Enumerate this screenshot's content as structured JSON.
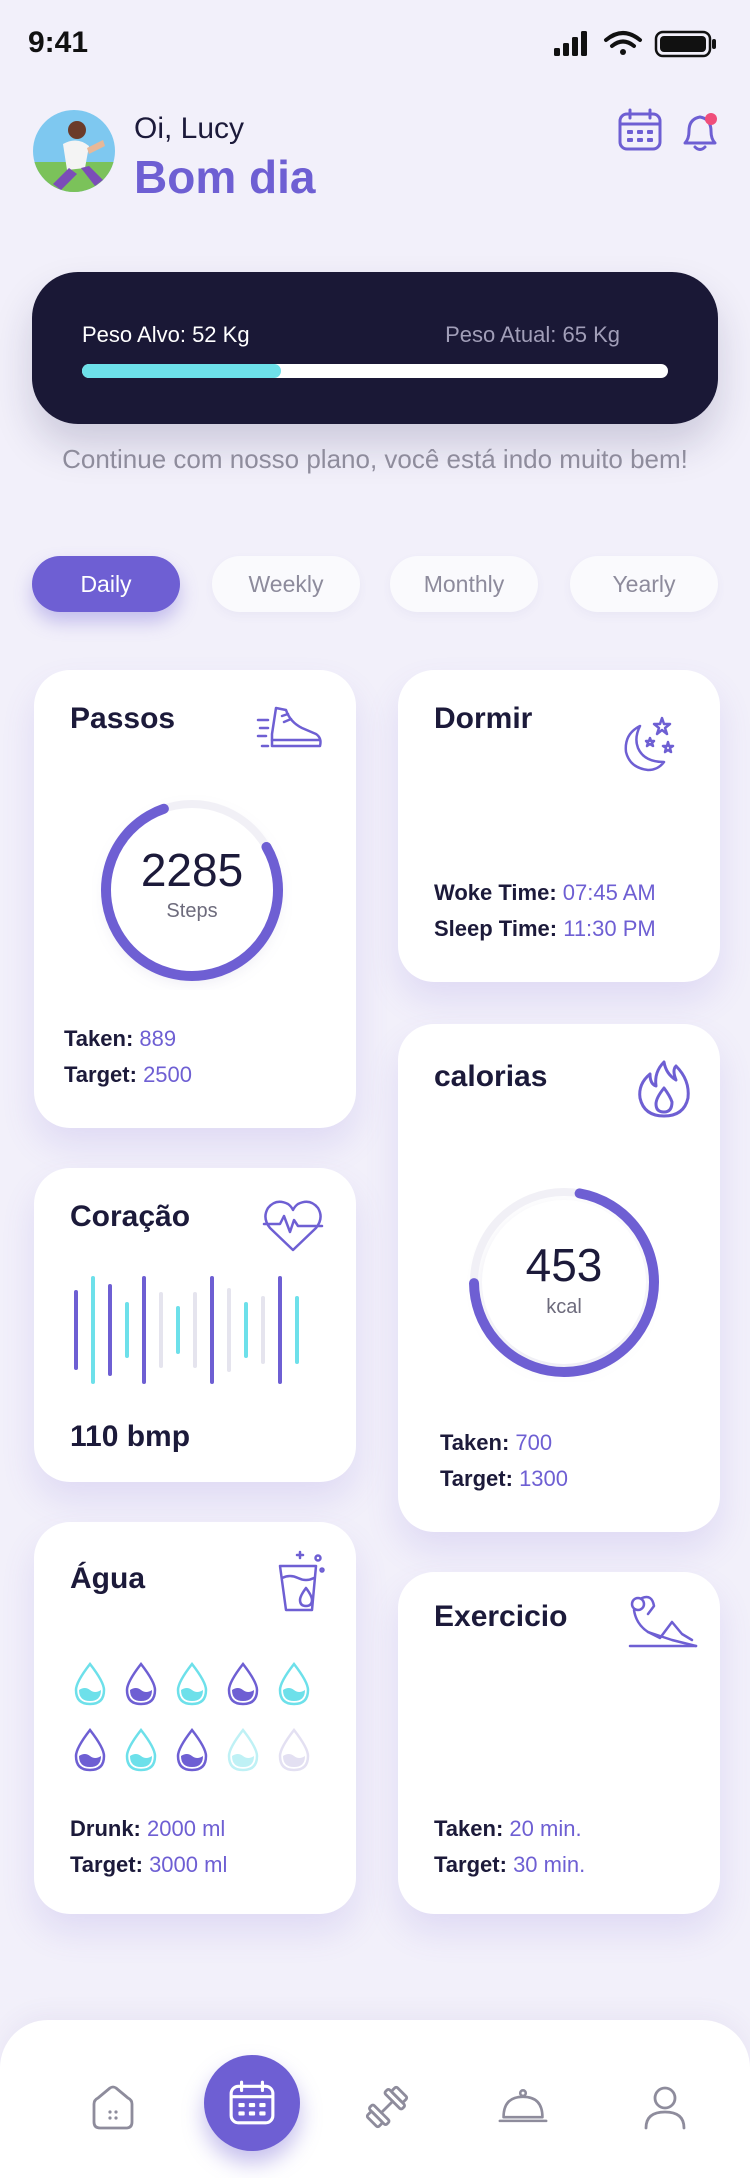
{
  "status_bar": {
    "time": "9:41"
  },
  "header": {
    "greeting": "Oi, Lucy",
    "subtitle": "Bom dia",
    "icons": [
      "calendar-icon",
      "bell-icon"
    ],
    "notification_dot_color": "#F04E7A"
  },
  "weight": {
    "target_label": "Peso Alvo: 52 Kg",
    "current_label": "Peso Atual: 65 Kg",
    "progress": 0.34,
    "motivation": "Continue com nosso plano, você está indo muito bem!"
  },
  "tabs": [
    {
      "label": "Daily",
      "active": true
    },
    {
      "label": "Weekly",
      "active": false
    },
    {
      "label": "Monthly",
      "active": false
    },
    {
      "label": "Yearly",
      "active": false
    }
  ],
  "cards": {
    "steps": {
      "title": "Passos",
      "icon": "shoe-icon",
      "value": "2285",
      "unit": "Steps",
      "progress": 0.78,
      "taken_label": "Taken:",
      "taken": "889",
      "target_label": "Target:",
      "target": "2500"
    },
    "sleep": {
      "title": "Dormir",
      "icon": "moon-stars-icon",
      "woke_label": "Woke Time:",
      "woke": "07:45 AM",
      "sleep_label": "Sleep Time:",
      "sleep": "11:30 PM"
    },
    "heart": {
      "title": "Coração",
      "icon": "heart-pulse-icon",
      "value": "110 bmp"
    },
    "calories": {
      "title": "calorias",
      "icon": "flame-icon",
      "value": "453",
      "unit": "kcal",
      "progress": 0.72,
      "taken_label": "Taken:",
      "taken": "700",
      "target_label": "Target:",
      "target": "1300"
    },
    "water": {
      "title": "Água",
      "icon": "glass-icon",
      "drunk_label": "Drunk:",
      "drunk": "2000 ml",
      "target_label": "Target:",
      "target": "3000 ml"
    },
    "exercise": {
      "title": "Exercicio",
      "icon": "situp-icon",
      "taken_label": "Taken:",
      "taken": "20 min.",
      "target_label": "Target:",
      "target": "30 min."
    }
  },
  "nav": {
    "items": [
      "home-icon",
      "calendar-icon",
      "dumbbell-icon",
      "cloche-icon",
      "user-icon"
    ],
    "active": "calendar-icon"
  },
  "colors": {
    "primary": "#6E5FD3",
    "accent_cyan": "#6DE0EA",
    "dark": "#1A1836",
    "background": "#F2F0FA"
  }
}
